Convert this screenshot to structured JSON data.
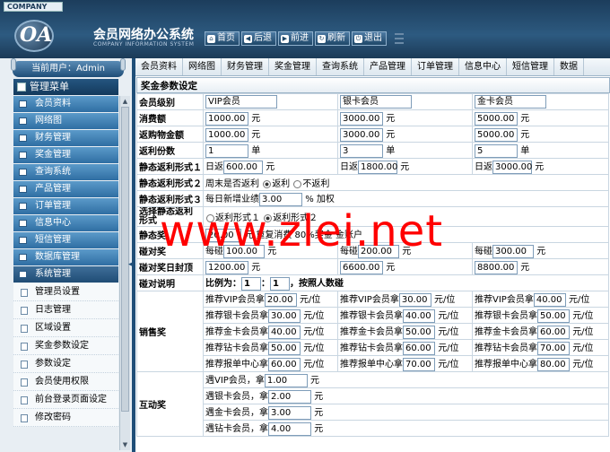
{
  "header": {
    "company": "COMPANY",
    "logo": "OA",
    "title": "会员网络办公系统",
    "subtitle": "COMPANY INFORMATION SYSTEM",
    "buttons": [
      {
        "label": "首页"
      },
      {
        "label": "后退"
      },
      {
        "label": "前进"
      },
      {
        "label": "刷新"
      },
      {
        "label": "退出"
      }
    ]
  },
  "sidebar": {
    "user": "当前用户：Admin",
    "menu_title": "管理菜单",
    "items": [
      {
        "label": "会员资料"
      },
      {
        "label": "网络图"
      },
      {
        "label": "财务管理"
      },
      {
        "label": "奖金管理"
      },
      {
        "label": "查询系统"
      },
      {
        "label": "产品管理"
      },
      {
        "label": "订单管理"
      },
      {
        "label": "信息中心"
      },
      {
        "label": "短信管理"
      },
      {
        "label": "数据库管理"
      },
      {
        "label": "系统管理"
      }
    ],
    "subitems": [
      {
        "label": "管理员设置"
      },
      {
        "label": "日志管理"
      },
      {
        "label": "区域设置"
      },
      {
        "label": "奖金参数设定"
      },
      {
        "label": "参数设定"
      },
      {
        "label": "会员使用权限"
      },
      {
        "label": "前台登录页面设定"
      },
      {
        "label": "修改密码"
      }
    ]
  },
  "tabs": [
    {
      "label": "会员资料"
    },
    {
      "label": "网络图"
    },
    {
      "label": "财务管理"
    },
    {
      "label": "奖金管理"
    },
    {
      "label": "查询系统"
    },
    {
      "label": "产品管理"
    },
    {
      "label": "订单管理"
    },
    {
      "label": "信息中心"
    },
    {
      "label": "短信管理"
    },
    {
      "label": "数据"
    }
  ],
  "form": {
    "title": "奖金参数设定",
    "level_label": "会员级别",
    "levels": [
      "VIP会员",
      "银卡会员",
      "金卡会员"
    ],
    "fee_label": "消费额",
    "fees": [
      "1000.00",
      "3000.00",
      "5000.00"
    ],
    "yuan": "元",
    "purchase_label": "返购物金额",
    "purchases": [
      "1000.00",
      "3000.00",
      "5000.00"
    ],
    "rebate_label": "返利份数",
    "rebates": [
      "1",
      "3",
      "5"
    ],
    "dan": "单",
    "static_label": "静态返利形式１",
    "daily": "日返",
    "statics": [
      "600.00",
      "1800.00",
      "3000.00"
    ],
    "static2_label": "静态返利形式２",
    "weekly_text": "周末是否返利",
    "rebate_on": "返利",
    "rebate_off": "不返利",
    "static3_label": "静态返利形式３",
    "daily_incr": "每日新增业绩",
    "incr_value": "3.00",
    "incr_unit": "% 加权",
    "choose_label": "选择静态返利形式",
    "form1": "返利形式１",
    "form2": "返利形式２",
    "jing_label": "静态奖",
    "jing_value": "20.00",
    "jing_text": "元 重复消费 80%奖金 金账户",
    "collide_label": "碰对奖",
    "per_collide": "每碰",
    "collides": [
      "100.00",
      "200.00",
      "300.00"
    ],
    "daycap_label": "碰对奖日封顶",
    "caps": [
      "1200.00",
      "6600.00",
      "8800.00"
    ],
    "desc_label": "碰对说明",
    "ratio_text": "比例为：",
    "ratio_a": "1",
    "colon": "：",
    "ratio_b": "1",
    "ratio_rule": "，按照人数碰",
    "sales_label": "销售奖",
    "sales": [
      [
        "推荐VIP会员拿",
        "20.00",
        "推荐VIP会员拿",
        "30.00",
        "推荐VIP会员拿",
        "40.00"
      ],
      [
        "推荐银卡会员拿",
        "30.00",
        "推荐银卡会员拿",
        "40.00",
        "推荐银卡会员拿",
        "50.00"
      ],
      [
        "推荐金卡会员拿",
        "40.00",
        "推荐金卡会员拿",
        "50.00",
        "推荐金卡会员拿",
        "60.00"
      ],
      [
        "推荐钻卡会员拿",
        "50.00",
        "推荐钻卡会员拿",
        "60.00",
        "推荐钻卡会员拿",
        "70.00"
      ],
      [
        "推荐报单中心拿",
        "60.00",
        "推荐报单中心拿",
        "70.00",
        "推荐报单中心拿",
        "80.00"
      ]
    ],
    "per_unit": "元/位",
    "interact_label": "互动奖",
    "interact": [
      [
        "遇VIP会员，拿",
        "1.00"
      ],
      [
        "遇银卡会员，拿",
        "2.00"
      ],
      [
        "遇金卡会员，拿",
        "3.00"
      ],
      [
        "遇钻卡会员，拿",
        "4.00"
      ]
    ]
  },
  "watermark": "www.zlei.net"
}
